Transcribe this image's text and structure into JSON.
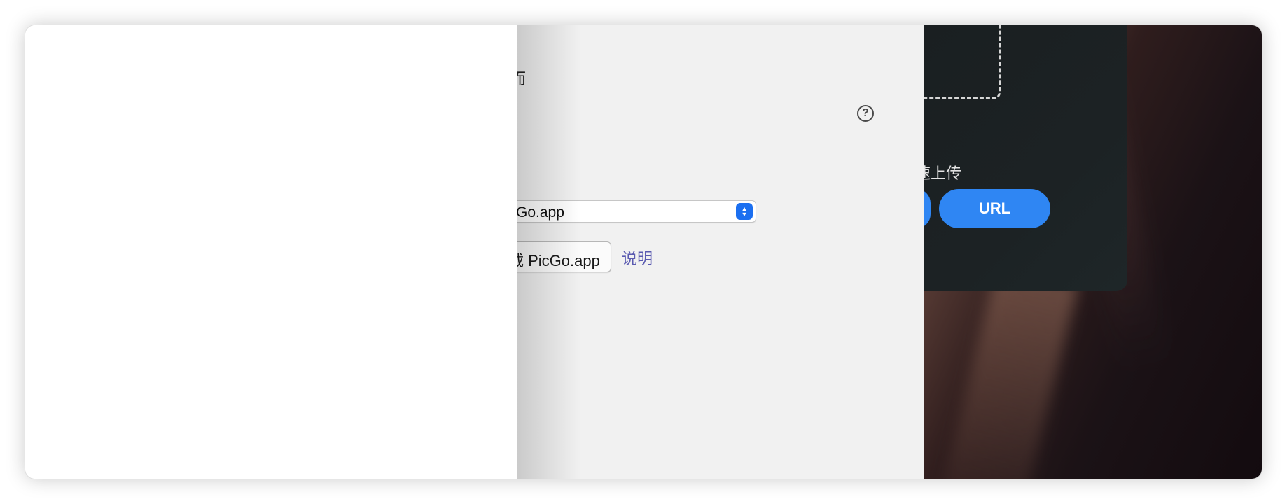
{
  "settings": {
    "heading_fragment": "而",
    "help_icon_label": "?",
    "app_select": {
      "value": "Go.app"
    },
    "download_button_label": "载 PicGo.app",
    "help_link_label": "说明"
  },
  "upload_panel": {
    "caption": "速上传",
    "url_button_label": "URL"
  },
  "colors": {
    "accent": "#2f86f3",
    "select_accent": "#1b6ff0",
    "link": "#5a5ab0",
    "panel_bg": "#f1f1f1",
    "card_bg": "#1c2224"
  },
  "icons": [
    "help-icon",
    "select-arrows-icon",
    "dashed-dropzone"
  ]
}
